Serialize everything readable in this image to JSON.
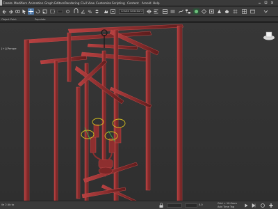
{
  "menu": {
    "items": [
      "Create",
      "Modifiers",
      "Animation",
      "Graph Editors",
      "Rendering",
      "Civil View",
      "Customize",
      "Scripting",
      "Content",
      "Arnold",
      "Help"
    ]
  },
  "toolbar": {
    "selection_set_placeholder": "Create Selection Se"
  },
  "ribbon": {
    "tabs": [
      "Object Paint",
      "Populate"
    ]
  },
  "viewport": {
    "label": "[+] [Perspe"
  },
  "status": {
    "left_text": "ile 2 Ab to",
    "add_time_tag": "Add Time Tag",
    "coord_value": "0.0",
    "grid_text": "Grid = 10.0mm"
  },
  "colors": {
    "frame": "#8e2f2f",
    "frame_edge": "#c24a4a",
    "ui_background": "#2b2b2b",
    "toolbar": "#3c3c3c",
    "selection_gizmo": "#d8c21e"
  }
}
